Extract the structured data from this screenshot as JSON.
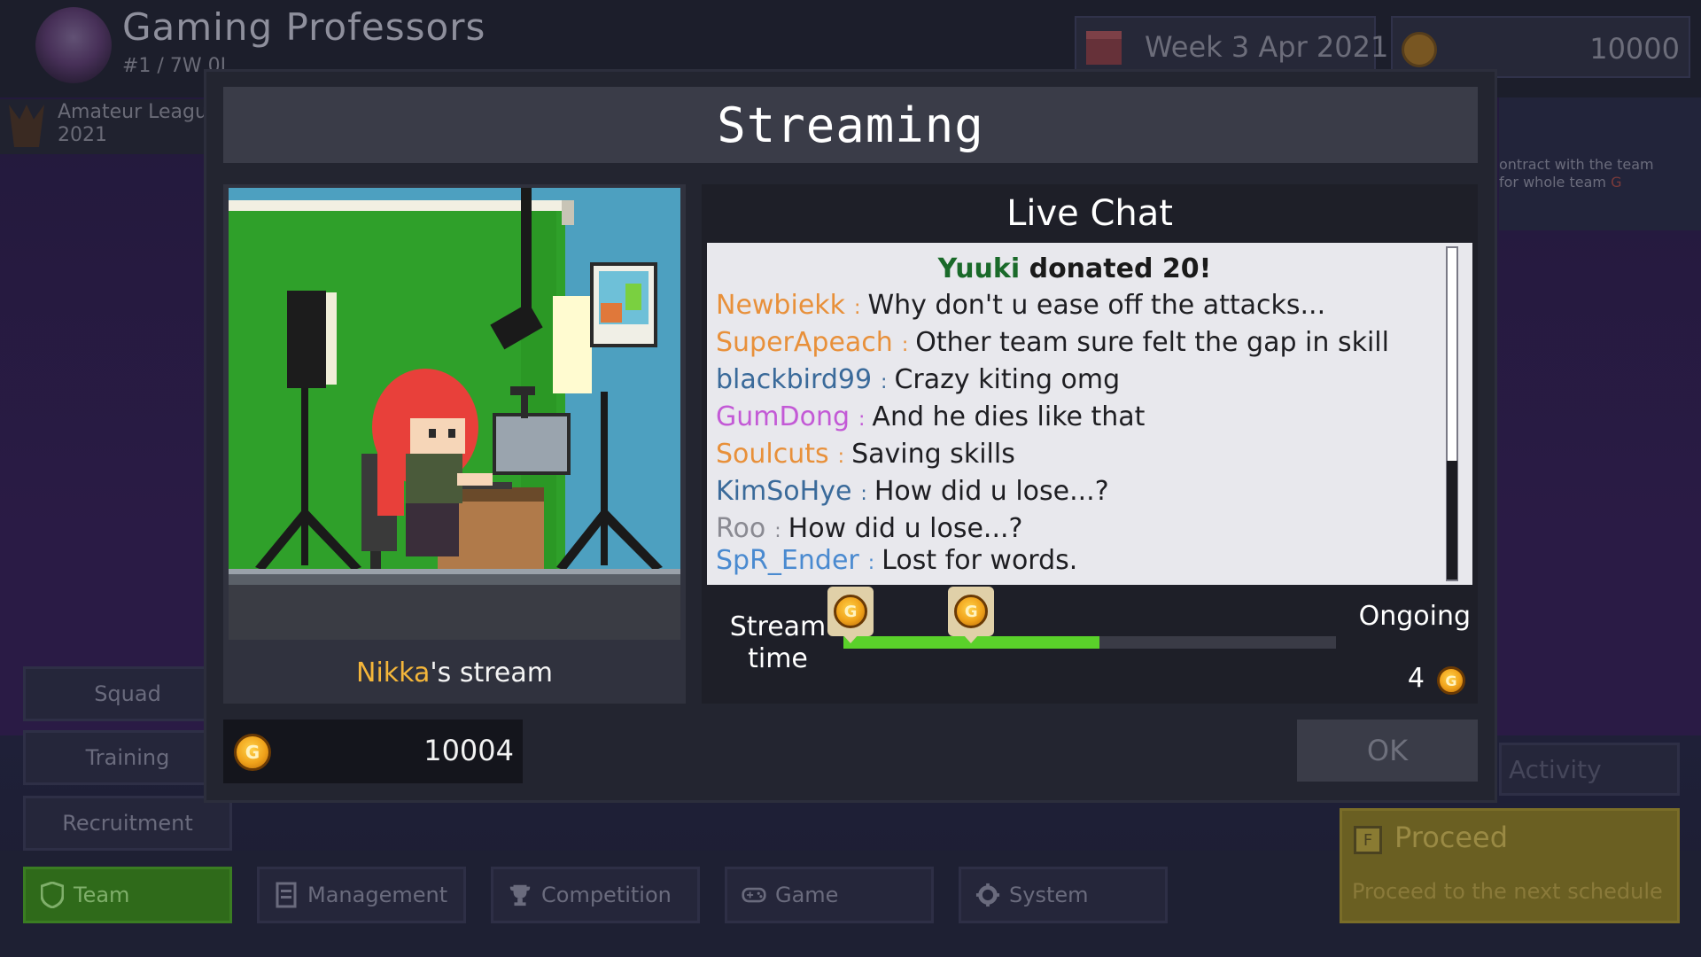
{
  "background": {
    "team_name": "Gaming Professors",
    "team_sub": "#1 / 7W 0L",
    "date": "Week 3 Apr 2021",
    "money_top": "10000",
    "league_name": "Amateur Leagu",
    "league_year": "2021",
    "right_panel": {
      "line1": "ontract with the team",
      "line2": "for whole team",
      "line2_value": "G"
    },
    "side_menu": [
      "Squad",
      "Training",
      "Recruitment"
    ],
    "nav": {
      "team": "Team",
      "management": "Management",
      "competition": "Competition",
      "game": "Game",
      "system": "System"
    },
    "activity_label": "Activity",
    "proceed": {
      "key": "F",
      "title": "Proceed",
      "subtitle": "Proceed to the next schedule"
    }
  },
  "dialog": {
    "title": "Streaming",
    "streamer": {
      "name": "Nikka",
      "suffix": "'s stream"
    },
    "chat": {
      "title": "Live Chat",
      "donation": {
        "donor": "Yuuki",
        "text": " donated 20!"
      },
      "separator": ":",
      "messages": [
        {
          "user": "Newbiekk",
          "text": "Why don't u ease off the attacks...",
          "color": "#e8903a"
        },
        {
          "user": "SuperApeach",
          "text": "Other team sure felt the gap in skill",
          "color": "#e8903a"
        },
        {
          "user": "blackbird99",
          "text": "Crazy kiting omg",
          "color": "#3a6a9a"
        },
        {
          "user": "GumDong",
          "text": "And he dies like that",
          "color": "#c35ad6"
        },
        {
          "user": "Soulcuts",
          "text": "Saving skills",
          "color": "#e8903a"
        },
        {
          "user": "KimSoHye",
          "text": "How did u lose...?",
          "color": "#3a6a9a"
        },
        {
          "user": "Roo",
          "text": "How did u lose...?",
          "color": "#8a8a92"
        },
        {
          "user": "SpR_Ender",
          "text": "Lost for words.",
          "color": "#4a8ad0"
        }
      ]
    },
    "stream_time_label": "Stream time",
    "progress": 0.52,
    "donation_markers": [
      0.0,
      0.245
    ],
    "status": "Ongoing",
    "earned": "4",
    "money": "10004",
    "ok_label": "OK",
    "coin_glyph": "G"
  },
  "colors": {
    "progress_fill": "#5ad12a",
    "donor_name": "#1a6a2a",
    "streamer_name": "#f4b63a",
    "active_nav": "#2f6a1a"
  }
}
